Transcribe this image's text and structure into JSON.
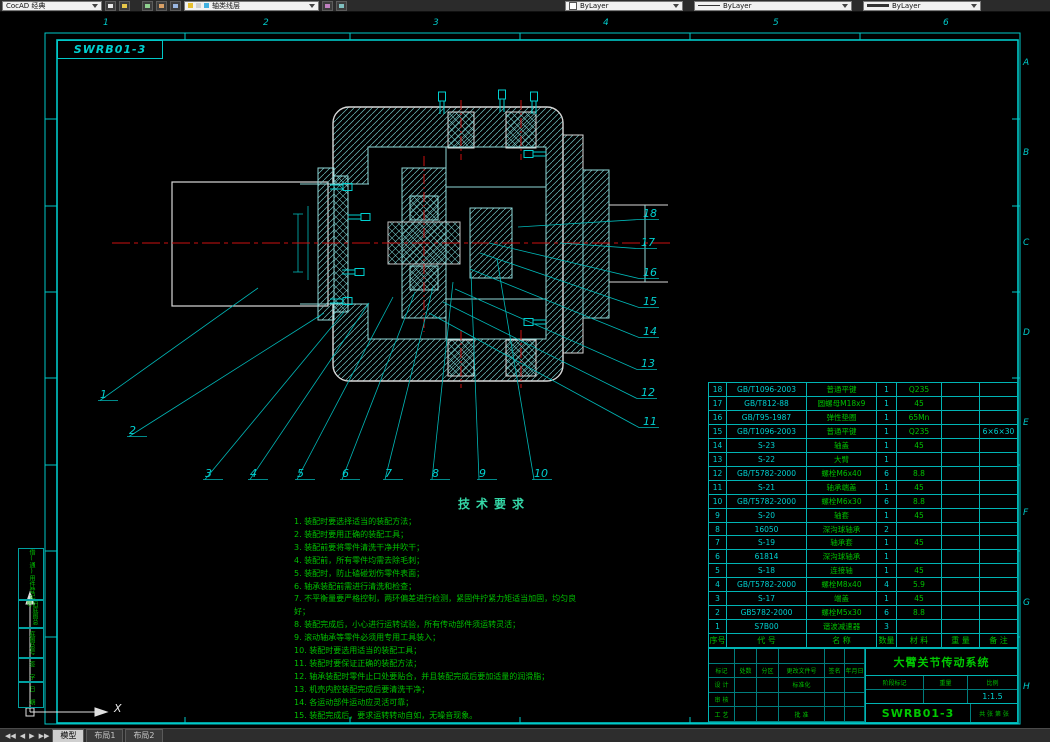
{
  "toolbar": {
    "workspace": "CocAD 经典",
    "layer_field": "轴类线层",
    "color_field": "ByLayer",
    "linetype_field": "ByLayer",
    "lineweight_field": "ByLayer"
  },
  "frame": {
    "doc_code": "SWRB01-3",
    "zone_cols": [
      "1",
      "2",
      "3",
      "4",
      "5",
      "6"
    ],
    "zone_rows": [
      "A",
      "B",
      "C",
      "D",
      "E",
      "F",
      "G",
      "H"
    ]
  },
  "callouts": [
    "1",
    "2",
    "3",
    "4",
    "5",
    "6",
    "7",
    "8",
    "9",
    "10",
    "11",
    "12",
    "13",
    "14",
    "15",
    "16",
    "17",
    "18"
  ],
  "tech": {
    "title": "技术要求",
    "items": [
      "1. 装配时要选择适当的装配方法；",
      "2. 装配时要用正确的装配工具；",
      "3. 装配前要将零件清洗干净并吹干；",
      "4. 装配前，所有零件均需去除毛刺；",
      "5. 装配时，防止磕碰划伤零件表面；",
      "6. 轴承装配前需进行清洗和检查；",
      "7. 不平衡量要严格控制，两环偏差进行检测，紧固件拧紧力矩适当加固，均匀良好；",
      "8. 装配完成后，小心进行运转试验，所有传动部件须运转灵活；",
      "9. 滚动轴承等零件必须用专用工具装入；",
      "10. 装配时要选用适当的装配工具；",
      "11. 装配时要保证正确的装配方法；",
      "12. 轴承装配时零件止口处要贴合，并且装配完成后要加适量的润滑脂；",
      "13. 机壳内腔装配完成后要清洗干净；",
      "14. 各运动部件运动应灵活可靠；",
      "15. 装配完成后，要求运转转动自如，无噪音现象。"
    ]
  },
  "bom": {
    "header": [
      "序号",
      "代  号",
      "名  称",
      "数量",
      "材  料",
      "重 量",
      "备 注"
    ],
    "rows": [
      {
        "no": "18",
        "code": "GB/T1096-2003",
        "name": "普通平键",
        "qty": "1",
        "material": "Q235",
        "weight": "",
        "remark": ""
      },
      {
        "no": "17",
        "code": "GB/T812-88",
        "name": "圆螺母M18x9",
        "qty": "1",
        "material": "45",
        "weight": "",
        "remark": ""
      },
      {
        "no": "16",
        "code": "GB/T95-1987",
        "name": "弹性垫圈",
        "qty": "1",
        "material": "65Mn",
        "weight": "",
        "remark": ""
      },
      {
        "no": "15",
        "code": "GB/T1096-2003",
        "name": "普通平键",
        "qty": "1",
        "material": "Q235",
        "weight": "",
        "remark": "6×6×30"
      },
      {
        "no": "14",
        "code": "S-23",
        "name": "轴盖",
        "qty": "1",
        "material": "45",
        "weight": "",
        "remark": ""
      },
      {
        "no": "13",
        "code": "S-22",
        "name": "大臂",
        "qty": "1",
        "material": "",
        "weight": "",
        "remark": ""
      },
      {
        "no": "12",
        "code": "GB/T5782-2000",
        "name": "螺栓M6x40",
        "qty": "6",
        "material": "8.8",
        "weight": "",
        "remark": ""
      },
      {
        "no": "11",
        "code": "S-21",
        "name": "轴承端盖",
        "qty": "1",
        "material": "45",
        "weight": "",
        "remark": ""
      },
      {
        "no": "10",
        "code": "GB/T5782-2000",
        "name": "螺栓M6x30",
        "qty": "6",
        "material": "8.8",
        "weight": "",
        "remark": ""
      },
      {
        "no": "9",
        "code": "S-20",
        "name": "轴套",
        "qty": "1",
        "material": "45",
        "weight": "",
        "remark": ""
      },
      {
        "no": "8",
        "code": "16050",
        "name": "深沟球轴承",
        "qty": "2",
        "material": "",
        "weight": "",
        "remark": ""
      },
      {
        "no": "7",
        "code": "S-19",
        "name": "轴承套",
        "qty": "1",
        "material": "45",
        "weight": "",
        "remark": ""
      },
      {
        "no": "6",
        "code": "61814",
        "name": "深沟球轴承",
        "qty": "1",
        "material": "",
        "weight": "",
        "remark": ""
      },
      {
        "no": "5",
        "code": "S-18",
        "name": "连接轴",
        "qty": "1",
        "material": "45",
        "weight": "",
        "remark": ""
      },
      {
        "no": "4",
        "code": "GB/T5782-2000",
        "name": "螺栓M8x40",
        "qty": "4",
        "material": "5.9",
        "weight": "",
        "remark": ""
      },
      {
        "no": "3",
        "code": "S-17",
        "name": "端盖",
        "qty": "1",
        "material": "45",
        "weight": "",
        "remark": ""
      },
      {
        "no": "2",
        "code": "GB5782-2000",
        "name": "螺栓M5x30",
        "qty": "6",
        "material": "8.8",
        "weight": "",
        "remark": ""
      },
      {
        "no": "1",
        "code": "S7B00",
        "name": "谐波减速器",
        "qty": "3",
        "material": "",
        "weight": "",
        "remark": ""
      }
    ]
  },
  "title_block": {
    "product_name": "大臂关节传动系统",
    "drawing_no": "SWRB01-3",
    "rows_left": [
      "标记",
      "处数",
      "分区",
      "更改文件号",
      "签名",
      "年月日"
    ],
    "roles": {
      "design": "设 计",
      "check": "审 核",
      "process": "工 艺",
      "approve": "批 准",
      "std": "标准化"
    },
    "labels": {
      "stage": "阶段标记",
      "weight": "重量",
      "scale": "比例"
    },
    "scale_value": "1:1.5",
    "sheet": "共 张 第 张"
  },
  "side_blocks": [
    "借(通)用件登记",
    "旧底图总号",
    "底图总号",
    "签 字",
    "日 期"
  ],
  "ucs": {
    "x_label": "X"
  },
  "tabs": {
    "nav": [
      "◀◀",
      "◀",
      "▶",
      "▶▶"
    ],
    "items": [
      "模型",
      "布局1",
      "布局2"
    ]
  }
}
